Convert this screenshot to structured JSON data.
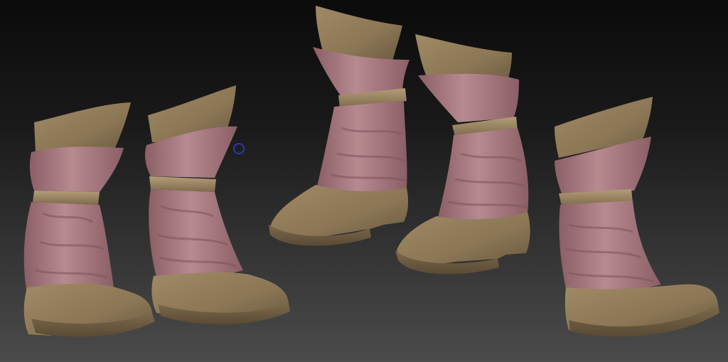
{
  "scene": {
    "background_top": "#0b0b0b",
    "background_bottom": "#4a4a4a",
    "leather_color": "#8b7655",
    "leather_shadow": "#6b5a40",
    "leather_light": "#a08a66",
    "cloth_color": "#a9777d",
    "cloth_shadow": "#7f565b",
    "cloth_light": "#c19096",
    "cursor_color": "#2a3aa8",
    "models": [
      {
        "name": "boot-model-1"
      },
      {
        "name": "boot-model-2"
      },
      {
        "name": "boot-model-3"
      },
      {
        "name": "boot-model-4"
      },
      {
        "name": "boot-model-5"
      }
    ]
  }
}
